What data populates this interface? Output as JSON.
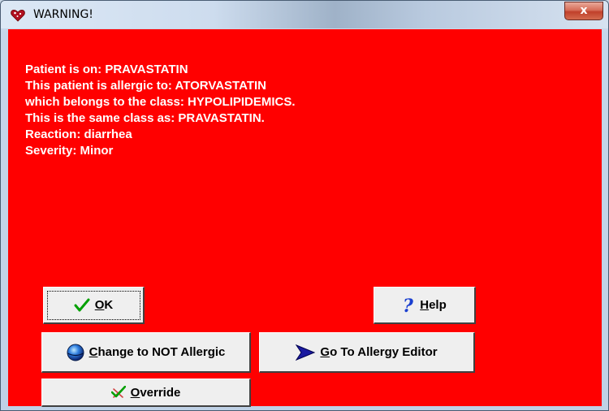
{
  "window": {
    "title": "WARNING!",
    "close_label": "x"
  },
  "message": {
    "lines": [
      "Patient is on: PRAVASTATIN",
      "This patient is allergic to: ATORVASTATIN",
      "which belongs to the class: HYPOLIPIDEMICS.",
      "This is the same class as: PRAVASTATIN.",
      "Reaction: diarrhea",
      "Severity: Minor"
    ]
  },
  "buttons": {
    "ok": {
      "mnemonic": "O",
      "rest": "K"
    },
    "help": {
      "mnemonic": "H",
      "rest": "elp"
    },
    "not_allergic": {
      "mnemonic": "C",
      "rest": "hange to NOT Allergic"
    },
    "allergy_editor": {
      "mnemonic": "G",
      "rest": "o To Allergy Editor"
    },
    "override": {
      "mnemonic": "O",
      "rest": "verride"
    }
  },
  "colors": {
    "background": "#ff0000",
    "text": "#ffffff",
    "check_green": "#00a000",
    "help_blue": "#1a3fd0",
    "arrow_navy": "#1a1aa0"
  },
  "icons": {
    "title": "heart-warning-icon",
    "ok": "checkmark-icon",
    "help": "question-mark-icon",
    "not_allergic": "blue-sphere-icon",
    "allergy_editor": "arrow-right-icon",
    "override": "check-cross-icon"
  }
}
